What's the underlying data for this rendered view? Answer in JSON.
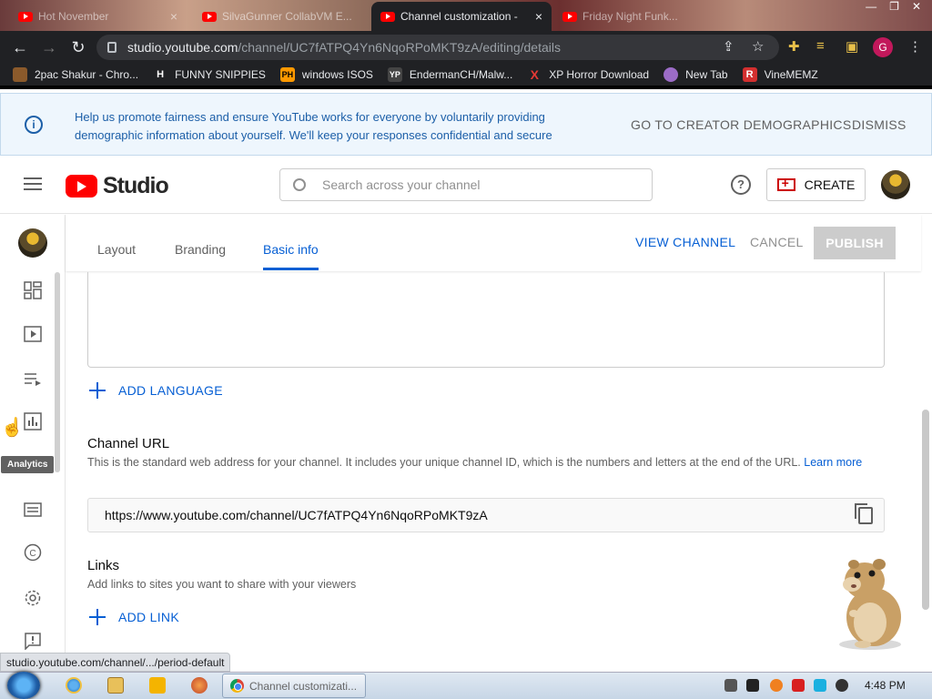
{
  "browser": {
    "tabs": [
      {
        "label": "Hot November"
      },
      {
        "label": "SilvaGunner CollabVM E..."
      },
      {
        "label": "Channel customization -"
      },
      {
        "label": "Friday Night Funk..."
      }
    ],
    "url_domain": "studio.youtube.com",
    "url_path": "/channel/UC7fATPQ4Yn6NqoRPoMKT9zA/editing/details",
    "profile_initial": "G",
    "bookmarks": [
      {
        "label": "2pac Shakur - Chro...",
        "icon": "avatar-icon",
        "color": "#8b5a2b"
      },
      {
        "label": "FUNNY SNIPPIES",
        "icon": "H",
        "color": "#ffffff"
      },
      {
        "label": "windows ISOS",
        "icon": "PH",
        "color": "#ff9900"
      },
      {
        "label": "EndermanCH/Malw...",
        "icon": "YP",
        "color": "#444444"
      },
      {
        "label": "XP Horror Download",
        "icon": "X",
        "color": "#e53935"
      },
      {
        "label": "New Tab",
        "icon": "globe-icon",
        "color": "#9c6cc7"
      },
      {
        "label": "VineMEMZ",
        "icon": "R",
        "color": "#d32f2f"
      }
    ]
  },
  "banner": {
    "message": "Help us promote fairness and ensure YouTube works for everyone by voluntarily providing demographic information about yourself. We'll keep your responses confidential and secure",
    "primary": "GO TO CREATOR DEMOGRAPHICS",
    "dismiss": "DISMISS"
  },
  "header": {
    "logo_text": "Studio",
    "search_placeholder": "Search across your channel",
    "create_label": "CREATE"
  },
  "subheader": {
    "tabs": [
      "Layout",
      "Branding",
      "Basic info"
    ],
    "active_tab": "Basic info",
    "view_channel": "VIEW CHANNEL",
    "cancel": "CANCEL",
    "publish": "PUBLISH"
  },
  "sidebar": {
    "tooltip": "Analytics",
    "icons": [
      "dashboard-icon",
      "content-icon",
      "playlists-icon",
      "analytics-icon",
      "comments-icon",
      "copyright-icon",
      "settings-icon",
      "feedback-icon"
    ]
  },
  "content": {
    "add_language": "ADD LANGUAGE",
    "channel_url": {
      "title": "Channel URL",
      "description": "This is the standard web address for your channel. It includes your unique channel ID, which is the numbers and letters at the end of the URL.",
      "learn_more": "Learn more",
      "value": "https://www.youtube.com/channel/UC7fATPQ4Yn6NqoRPoMKT9zA"
    },
    "links": {
      "title": "Links",
      "description": "Add links to sites you want to share with your viewers",
      "add_link": "ADD LINK"
    }
  },
  "status_url": "studio.youtube.com/channel/.../period-default",
  "taskbar": {
    "active_window": "Channel customizati...",
    "clock": "4:48 PM"
  }
}
